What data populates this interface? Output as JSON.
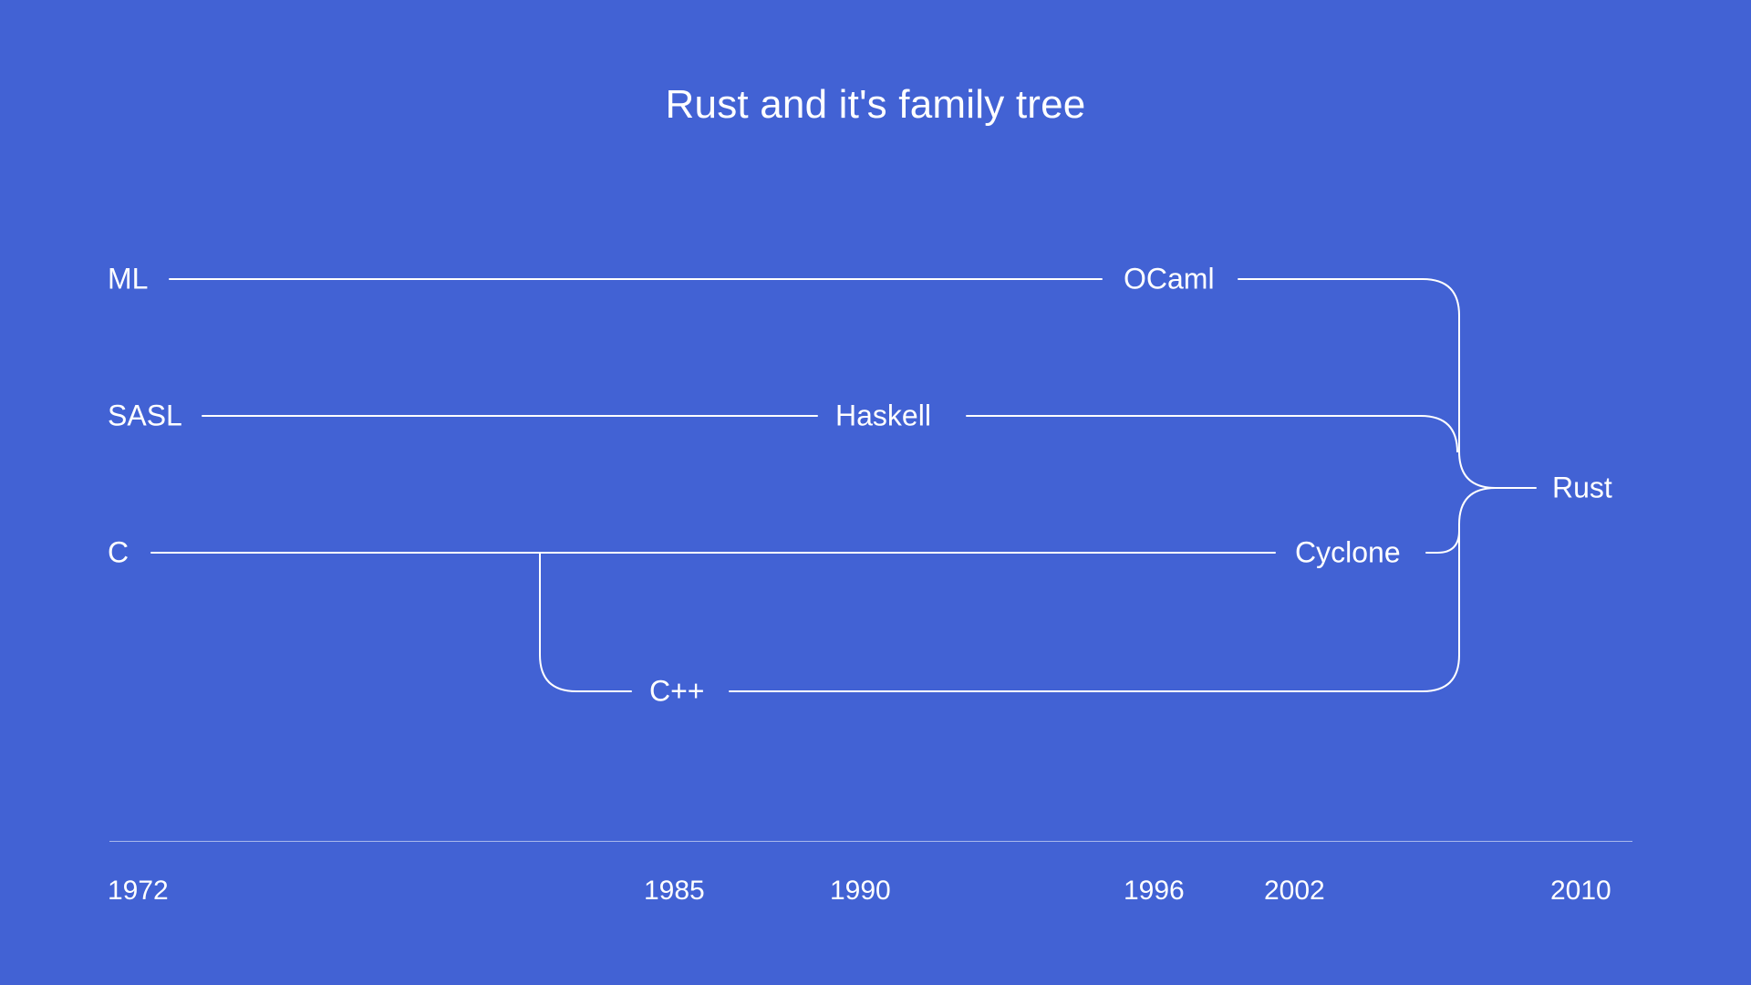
{
  "title": "Rust and it's family tree",
  "nodes": {
    "ml": {
      "label": "ML",
      "year": 1972
    },
    "sasl": {
      "label": "SASL",
      "year": 1972
    },
    "c": {
      "label": "C",
      "year": 1972
    },
    "ocaml": {
      "label": "OCaml",
      "year": 1996
    },
    "haskell": {
      "label": "Haskell",
      "year": 1990
    },
    "cyclone": {
      "label": "Cyclone",
      "year": 2002
    },
    "cpp": {
      "label": "C++",
      "year": 1985
    },
    "rust": {
      "label": "Rust",
      "year": 2010
    }
  },
  "timeline": {
    "ticks": [
      "1972",
      "1985",
      "1990",
      "1996",
      "2002",
      "2010"
    ]
  },
  "chart_data": {
    "type": "table",
    "title": "Rust and it's family tree",
    "nodes": [
      {
        "id": "ml",
        "label": "ML",
        "year": 1972
      },
      {
        "id": "sasl",
        "label": "SASL",
        "year": 1972
      },
      {
        "id": "c",
        "label": "C",
        "year": 1972
      },
      {
        "id": "cpp",
        "label": "C++",
        "year": 1985
      },
      {
        "id": "haskell",
        "label": "Haskell",
        "year": 1990
      },
      {
        "id": "ocaml",
        "label": "OCaml",
        "year": 1996
      },
      {
        "id": "cyclone",
        "label": "Cyclone",
        "year": 2002
      },
      {
        "id": "rust",
        "label": "Rust",
        "year": 2010
      }
    ],
    "edges": [
      {
        "from": "ml",
        "to": "ocaml"
      },
      {
        "from": "sasl",
        "to": "haskell"
      },
      {
        "from": "c",
        "to": "cyclone"
      },
      {
        "from": "c",
        "to": "cpp"
      },
      {
        "from": "ocaml",
        "to": "rust"
      },
      {
        "from": "haskell",
        "to": "rust"
      },
      {
        "from": "cyclone",
        "to": "rust"
      },
      {
        "from": "cpp",
        "to": "rust"
      }
    ],
    "timeline_ticks": [
      1972,
      1985,
      1990,
      1996,
      2002,
      2010
    ]
  }
}
